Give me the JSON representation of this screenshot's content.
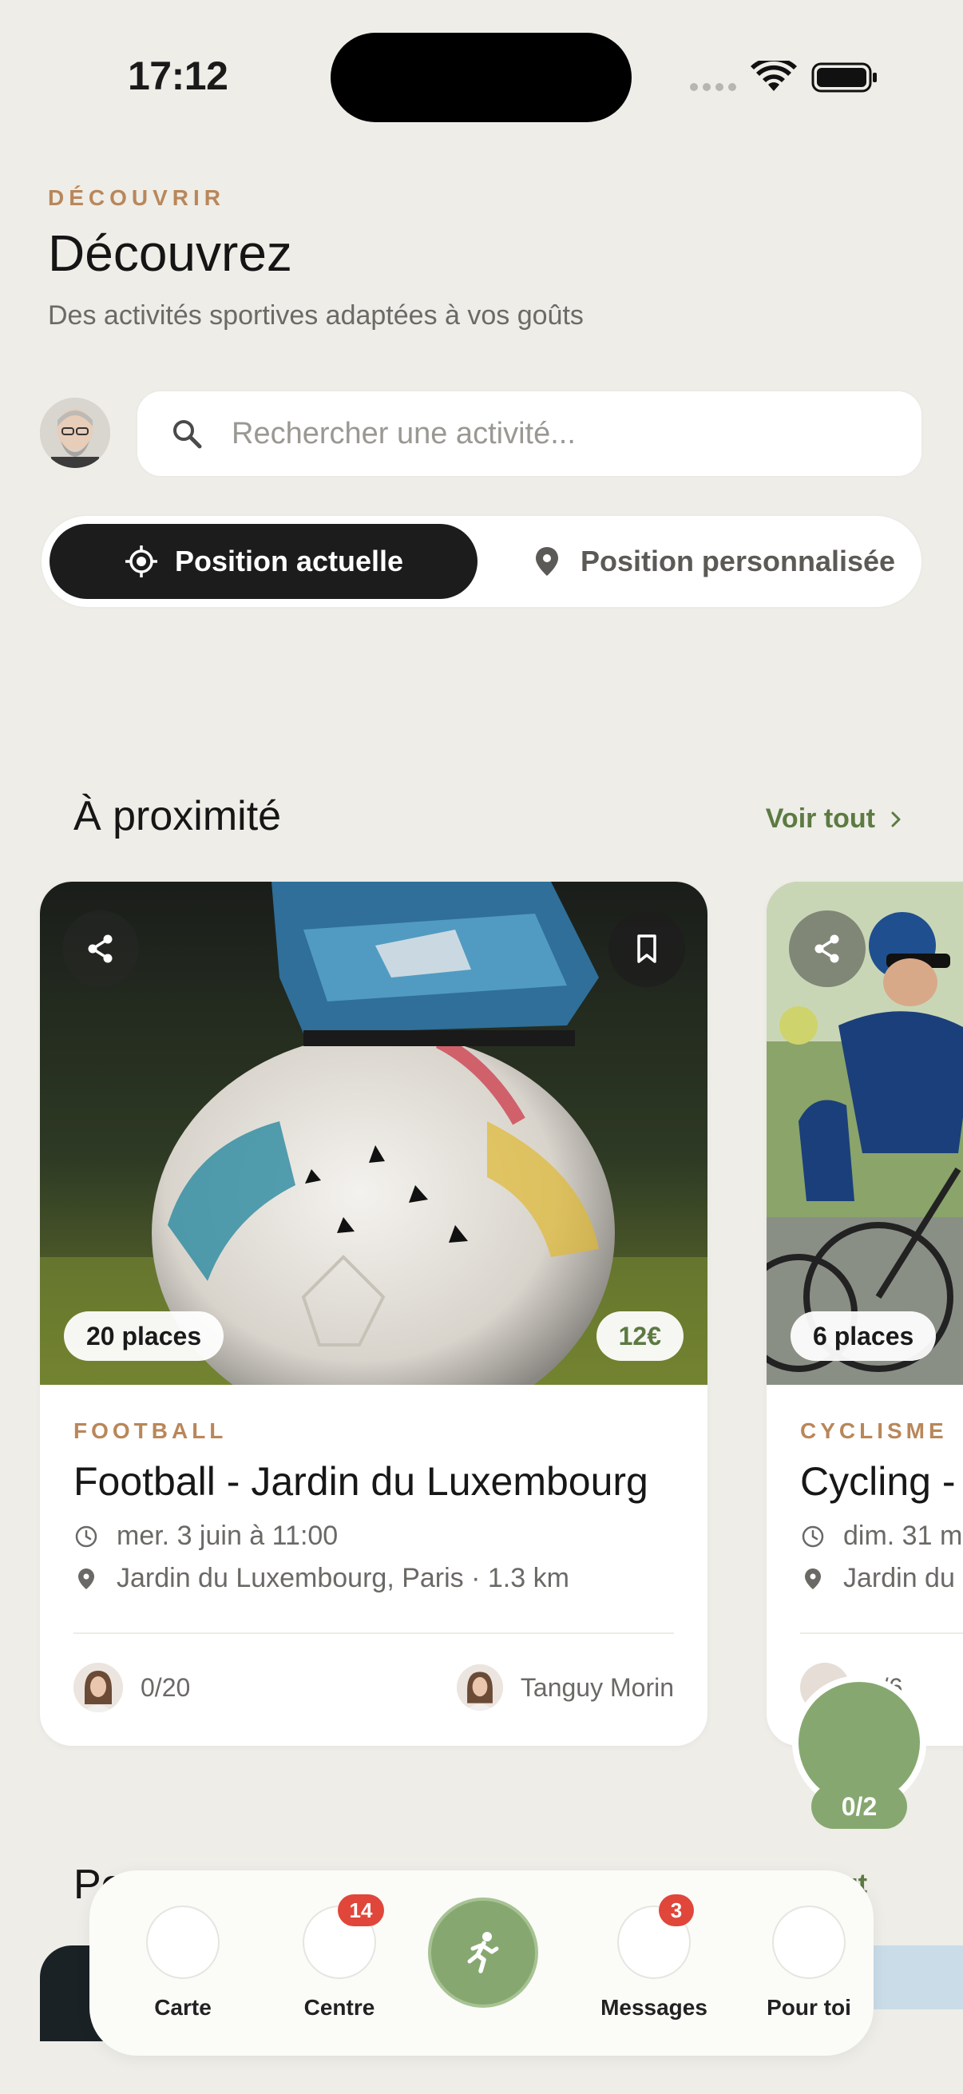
{
  "status_bar": {
    "time": "17:12"
  },
  "header": {
    "eyebrow": "DÉCOUVRIR",
    "title": "Découvrez",
    "subtitle": "Des activités sportives adaptées à vos goûts"
  },
  "search": {
    "placeholder": "Rechercher une activité..."
  },
  "location_toggle": {
    "current": "Position actuelle",
    "custom": "Position personnalisée",
    "selected": "Position actuelle"
  },
  "nearby": {
    "title": "À proximité",
    "see_all": "Voir tout",
    "cards": [
      {
        "places": "20 places",
        "price": "12€",
        "sport": "FOOTBALL",
        "title": "Football - Jardin du Luxembourg",
        "date": "mer. 3 juin à 11:00",
        "location": "Jardin du Luxembourg, Paris · 1.3 km",
        "participants": "0/20",
        "organizer": "Tanguy Morin"
      },
      {
        "places": "6 places",
        "sport": "CYCLISME",
        "title": "Cycling -",
        "date": "dim. 31 m",
        "location": "Jardin du",
        "participants": "0/6"
      }
    ]
  },
  "progress": {
    "label": "0/2"
  },
  "section2": {
    "title": "Po",
    "see_all": "ut"
  },
  "tabbar": {
    "tabs": [
      {
        "label": "Carte"
      },
      {
        "label": "Centre",
        "badge": "14"
      },
      {
        "label": "Messages",
        "badge": "3"
      },
      {
        "label": "Pour toi"
      }
    ],
    "center_icon": "running-person-icon"
  },
  "colors": {
    "background": "#eeede8",
    "accent_green": "#86a870",
    "link_green": "#5c7a42",
    "eyebrow_tan": "#b9875a",
    "badge_red": "#e0463a"
  }
}
